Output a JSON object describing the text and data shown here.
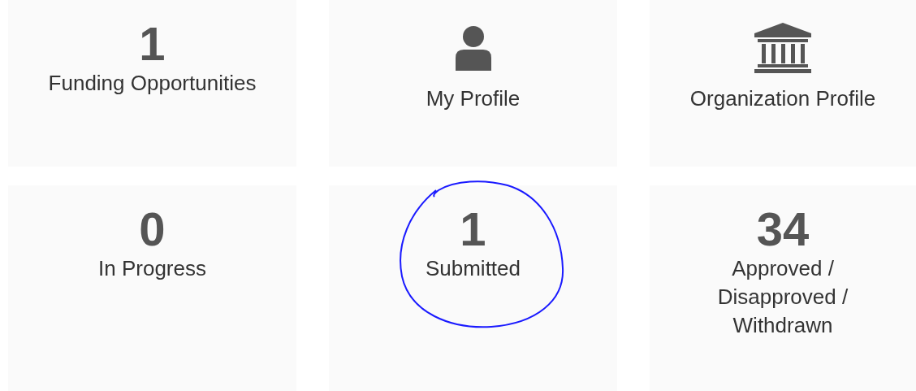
{
  "tiles": [
    {
      "kind": "count",
      "value": "1",
      "label": "Funding Opportunities",
      "circled": false
    },
    {
      "kind": "person",
      "label": "My Profile",
      "circled": false
    },
    {
      "kind": "bank",
      "label": "Organization Profile",
      "circled": false
    },
    {
      "kind": "count",
      "value": "0",
      "label": "In Progress",
      "circled": false
    },
    {
      "kind": "count",
      "value": "1",
      "label": "Submitted",
      "circled": true
    },
    {
      "kind": "count",
      "value": "34",
      "label": "Approved / Disapproved / Withdrawn",
      "circled": false
    }
  ]
}
